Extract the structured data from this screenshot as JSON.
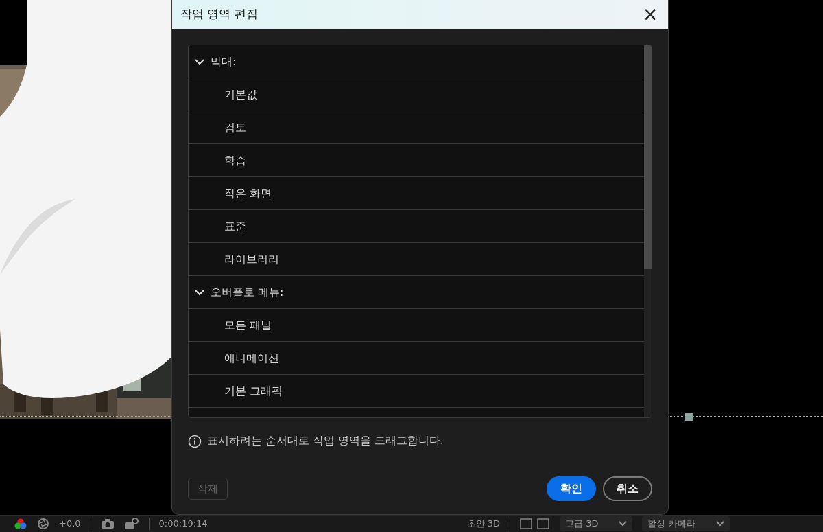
{
  "dialog": {
    "title": "작업 영역 편집",
    "close": "×",
    "groups": [
      {
        "label": "막대:",
        "expanded": true,
        "children": [
          {
            "label": "기본값"
          },
          {
            "label": "검토"
          },
          {
            "label": "학습"
          },
          {
            "label": "작은 화면"
          },
          {
            "label": "표준"
          },
          {
            "label": "라이브러리"
          }
        ]
      },
      {
        "label": "오버플로 메뉴:",
        "expanded": true,
        "children": [
          {
            "label": "모든 패널"
          },
          {
            "label": "애니메이션"
          },
          {
            "label": "기본 그래픽"
          }
        ]
      }
    ],
    "info": "표시하려는 순서대로 작업 영역을 드래그합니다.",
    "buttons": [
      {
        "label": "삭제",
        "kind": "delete",
        "disabled": true
      },
      {
        "label": "확인",
        "kind": "primary",
        "disabled": false
      },
      {
        "label": "취소",
        "kind": "secondary",
        "disabled": false
      }
    ]
  },
  "toolbar": {
    "exposure": "+0.0",
    "timecode": "0:00:19:14",
    "draft": "초안 3D",
    "renderer": "고급 3D",
    "camera": "활성 카메라"
  }
}
